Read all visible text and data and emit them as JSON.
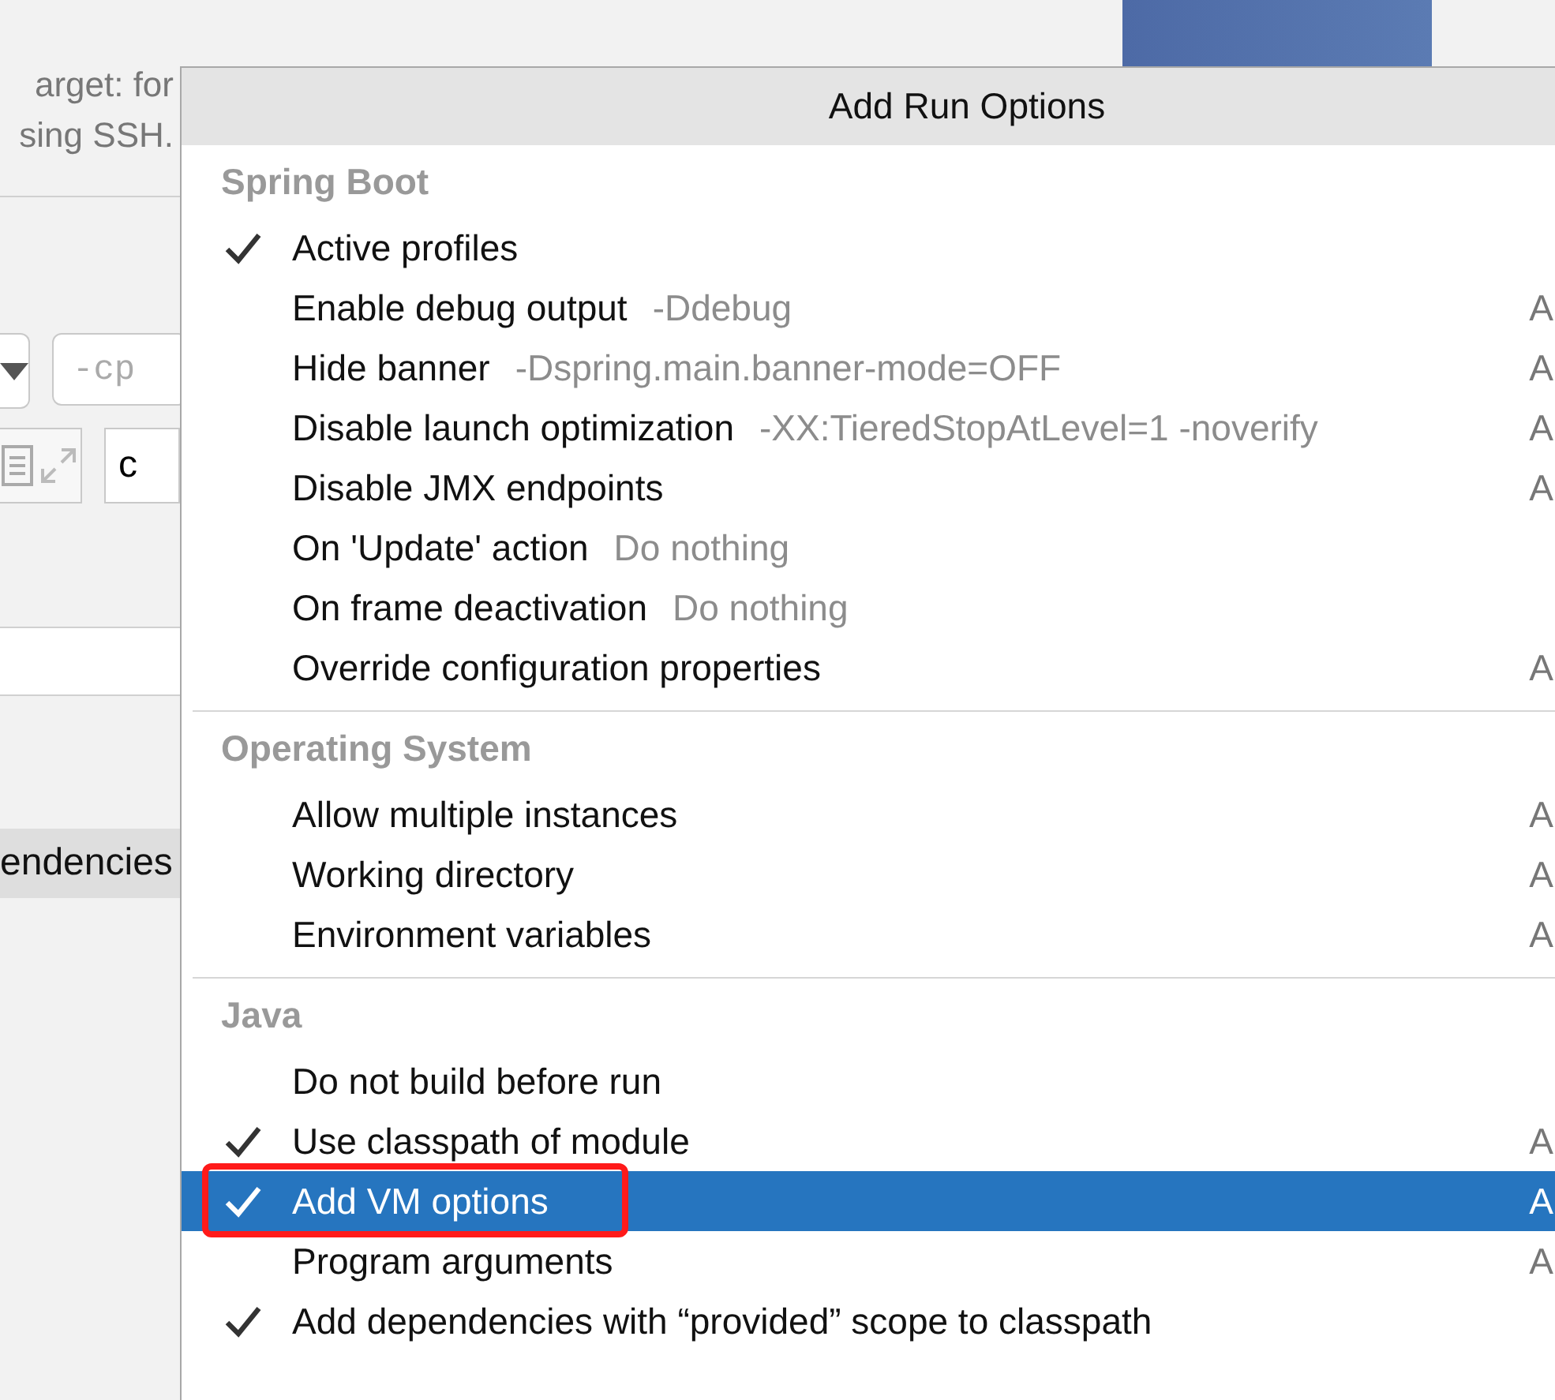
{
  "background": {
    "description_lines": [
      "arget: for",
      "sing SSH."
    ],
    "cp_field": {
      "placeholder": "-cp"
    },
    "main_class_field": {
      "value": "c"
    },
    "list_row": {
      "label": "endencies",
      "selected": true
    }
  },
  "popup": {
    "title": "Add Run Options",
    "sections": [
      {
        "heading": "Spring Boot",
        "items": [
          {
            "label": "Active profiles",
            "checked": true,
            "selected": false
          },
          {
            "label": "Enable debug output",
            "hint": "-Ddebug",
            "shortcut": "A",
            "checked": false,
            "selected": false
          },
          {
            "label": "Hide banner",
            "hint": "-Dspring.main.banner-mode=OFF",
            "shortcut": "A",
            "checked": false,
            "selected": false
          },
          {
            "label": "Disable launch optimization",
            "hint": "-XX:TieredStopAtLevel=1 -noverify",
            "shortcut": "A",
            "checked": false,
            "selected": false
          },
          {
            "label": "Disable JMX endpoints",
            "shortcut": "A",
            "checked": false,
            "selected": false
          },
          {
            "label": "On 'Update' action",
            "hint": "Do nothing",
            "checked": false,
            "selected": false
          },
          {
            "label": "On frame deactivation",
            "hint": "Do nothing",
            "checked": false,
            "selected": false
          },
          {
            "label": "Override configuration properties",
            "shortcut": "A",
            "checked": false,
            "selected": false
          }
        ]
      },
      {
        "heading": "Operating System",
        "items": [
          {
            "label": "Allow multiple instances",
            "shortcut": "A",
            "checked": false,
            "selected": false
          },
          {
            "label": "Working directory",
            "shortcut": "A",
            "checked": false,
            "selected": false
          },
          {
            "label": "Environment variables",
            "shortcut": "A",
            "checked": false,
            "selected": false
          }
        ]
      },
      {
        "heading": "Java",
        "items": [
          {
            "label": "Do not build before run",
            "checked": false,
            "selected": false
          },
          {
            "label": "Use classpath of module",
            "shortcut": "A",
            "checked": true,
            "selected": false
          },
          {
            "label": "Add VM options",
            "shortcut": "A",
            "checked": true,
            "selected": true,
            "highlighted": true
          },
          {
            "label": "Program arguments",
            "shortcut": "A",
            "checked": false,
            "selected": false
          },
          {
            "label": "Add dependencies with “provided” scope to classpath",
            "checked": true,
            "selected": false
          }
        ]
      }
    ]
  }
}
